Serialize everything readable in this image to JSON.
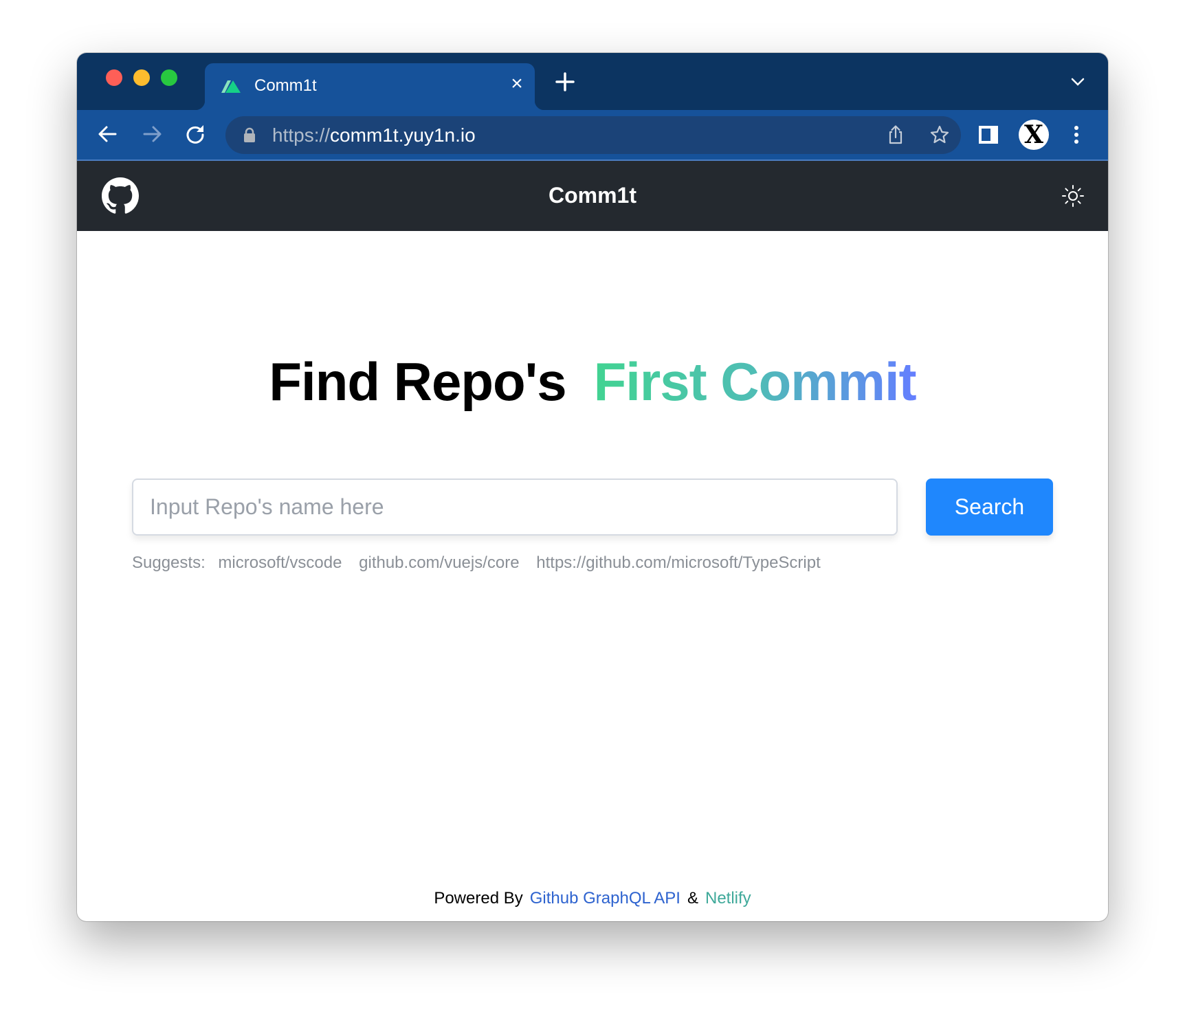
{
  "browser": {
    "tab": {
      "title": "Comm1t",
      "favicon": "vite-triangles-icon"
    },
    "address_bar": {
      "scheme": "https://",
      "host": "comm1t.yuy1n.io"
    },
    "profile_initial": "X",
    "icons": {
      "back": "arrow-left-icon",
      "forward": "arrow-right-icon",
      "reload": "reload-icon",
      "lock": "lock-icon",
      "share": "share-icon",
      "bookmark": "star-icon",
      "side_panel": "side-panel-icon",
      "menu": "kebab-menu-icon",
      "new_tab": "plus-icon",
      "tab_list": "chevron-down-icon",
      "close_tab": "close-icon"
    },
    "close_glyph": "×"
  },
  "header": {
    "title": "Comm1t",
    "left_icon": "github-icon",
    "right_icon": "sun-icon"
  },
  "main": {
    "heading_part1": "Find Repo's",
    "heading_part2": "First Commit",
    "heading_gradient": [
      "#42d392",
      "#647eff"
    ],
    "search": {
      "placeholder": "Input Repo's name here",
      "value": "",
      "button_label": "Search",
      "button_color": "#1f87fd"
    },
    "suggests": {
      "label": "Suggests:",
      "items": [
        "microsoft/vscode",
        "github.com/vuejs/core",
        "https://github.com/microsoft/TypeScript"
      ]
    }
  },
  "footer": {
    "prefix": "Powered By",
    "link1": "Github GraphQL API",
    "separator": "&",
    "link2": "Netlify"
  }
}
